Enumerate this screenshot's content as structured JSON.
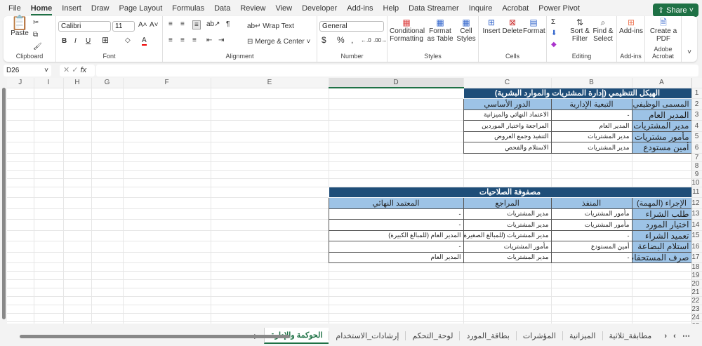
{
  "menu": [
    "File",
    "Home",
    "Insert",
    "Draw",
    "Page Layout",
    "Formulas",
    "Data",
    "Review",
    "View",
    "Developer",
    "Add-ins",
    "Help",
    "Data Streamer",
    "Inquire",
    "Acrobat",
    "Power Pivot"
  ],
  "share": "Share",
  "ribbon": {
    "paste": "Paste",
    "clipboard": "Clipboard",
    "font_name": "Calibri",
    "font_size": "11",
    "font": "Font",
    "wrap": "Wrap Text",
    "merge": "Merge & Center",
    "alignment": "Alignment",
    "number_format": "General",
    "number": "Number",
    "cond": "Conditional Formatting",
    "fmt_table": "Format as Table",
    "cell_styles": "Cell Styles",
    "styles": "Styles",
    "insert": "Insert",
    "delete": "Delete",
    "format": "Format",
    "cells": "Cells",
    "sort": "Sort & Filter",
    "find": "Find & Select",
    "editing": "Editing",
    "addins": "Add-ins",
    "addins_grp": "Add-ins",
    "pdf": "Create a PDF",
    "acrobat": "Adobe Acrobat"
  },
  "formula": {
    "namebox": "D26",
    "fx": "fx"
  },
  "columns": [
    "A",
    "B",
    "C",
    "D",
    "E",
    "F",
    "G",
    "H",
    "I",
    "J"
  ],
  "table1": {
    "title": "الهيكل التنظيمي (إدارة المشتريات والموارد البشرية)",
    "headers": [
      "المسمى الوظيفي",
      "التبعية الإدارية",
      "الدور الأساسي"
    ],
    "rows": [
      [
        "المدير العام",
        "-",
        "الاعتماد النهائي والميزانية"
      ],
      [
        "مدير المشتريات",
        "المدير العام",
        "المراجعة واختيار الموردين"
      ],
      [
        "مأمور مشتريات",
        "مدير المشتريات",
        "التنفيذ وجمع العروض"
      ],
      [
        "أمين مستودع",
        "مدير المشتريات",
        "الاستلام والفحص"
      ]
    ]
  },
  "table2": {
    "title": "مصفوفة الصلاحيات",
    "headers": [
      "الإجراء (المهمة)",
      "المنفذ",
      "المراجع",
      "المعتمد النهائي"
    ],
    "rows": [
      [
        "طلب الشراء",
        "مأمور المشتريات",
        "مدير المشتريات",
        "-"
      ],
      [
        "اختيار المورد",
        "مأمور المشتريات",
        "مدير المشتريات",
        "-"
      ],
      [
        "تعميد الشراء",
        "-",
        "مدير المشتريات (للمبالغ الصغيرة)",
        "المدير العام (للمبالغ الكبيرة)"
      ],
      [
        "استلام البضاعة",
        "أمين المستودع",
        "مأمور المشتريات",
        "-"
      ],
      [
        "صرف المستحقات",
        "-",
        "مدير المشتريات",
        "المدير العام"
      ]
    ]
  },
  "sheets": [
    "الحوكمة والإدارة",
    "إرشادات_الاستخدام",
    "لوحة_التحكم",
    "بطاقة_المورد",
    "المؤشرات",
    "الميزانية",
    "مطابقة_ثلاثية"
  ],
  "active_sheet": 0
}
